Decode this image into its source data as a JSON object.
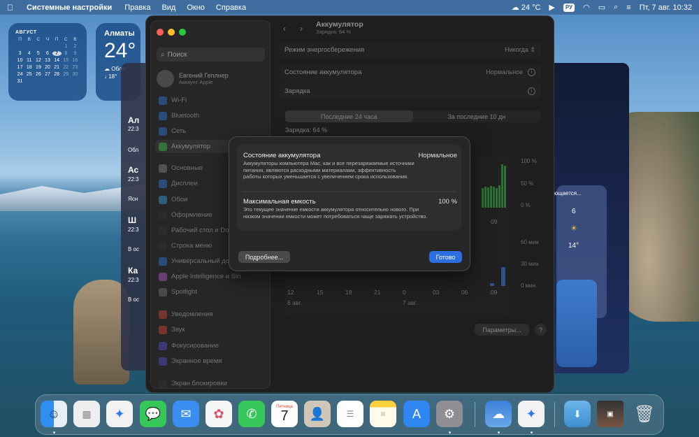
{
  "menubar": {
    "app_name": "Системные настройки",
    "menus": [
      "Правка",
      "Вид",
      "Окно",
      "Справка"
    ],
    "weather": "24 °C",
    "keyboard": "РУ",
    "datetime": "Пт, 7 авг.  10:32"
  },
  "calendar_widget": {
    "month": "АВГУСТ",
    "weekdays": [
      "П",
      "В",
      "С",
      "Ч",
      "П",
      "С",
      "В"
    ],
    "days": [
      "",
      "",
      "",
      "",
      "",
      "1",
      "2",
      "3",
      "4",
      "5",
      "6",
      "7",
      "8",
      "9",
      "10",
      "11",
      "12",
      "13",
      "14",
      "15",
      "16",
      "17",
      "18",
      "19",
      "20",
      "21",
      "22",
      "23",
      "24",
      "25",
      "26",
      "27",
      "28",
      "29",
      "30",
      "31"
    ],
    "today": "7"
  },
  "weather_widget": {
    "city": "Алматы",
    "temp": "24°",
    "condition": "Обла",
    "low": "↓ 18°"
  },
  "bg_left_window": {
    "items": [
      "Ал",
      "22:3",
      "Обл",
      "Ас",
      "22:3",
      "Ясн",
      "Ш",
      "22:3",
      "В ос",
      "Ка",
      "22:3",
      "В ос"
    ]
  },
  "bg_right_window": {
    "text1": "ющается...",
    "num": "6",
    "temp": "14°"
  },
  "sidebar": {
    "search_placeholder": "Поиск",
    "account_name": "Евгений Геплнер",
    "account_sub": "Аккаунт Apple",
    "items": [
      {
        "label": "Wi-Fi",
        "color": "#2f7be0"
      },
      {
        "label": "Bluetooth",
        "color": "#2f7be0"
      },
      {
        "label": "Сеть",
        "color": "#2f7be0"
      },
      {
        "label": "Аккумулятор",
        "color": "#3bb34a"
      },
      {
        "label": "Основные",
        "color": "#888888"
      },
      {
        "label": "Дисплеи",
        "color": "#2f7be0"
      },
      {
        "label": "Обои",
        "color": "#34a8e0"
      },
      {
        "label": "Оформление",
        "color": "#333333"
      },
      {
        "label": "Рабочий стол и Dock",
        "color": "#333333"
      },
      {
        "label": "Строка меню",
        "color": "#333333"
      },
      {
        "label": "Универсальный доступ",
        "color": "#2f7be0"
      },
      {
        "label": "Apple Intelligence и Siri",
        "color": "#c05ad6"
      },
      {
        "label": "Spotlight",
        "color": "#777777"
      },
      {
        "label": "Уведомления",
        "color": "#e0453a"
      },
      {
        "label": "Звук",
        "color": "#e0453a"
      },
      {
        "label": "Фокусирование",
        "color": "#5a4fd6"
      },
      {
        "label": "Экранное время",
        "color": "#5a4fd6"
      },
      {
        "label": "Экран блокировки",
        "color": "#333333"
      }
    ]
  },
  "content": {
    "title": "Аккумулятор",
    "subtitle": "Зарядка: 64 %",
    "low_power_label": "Режим энергосбережения",
    "low_power_value": "Никогда",
    "health_label": "Состояние аккумулятора",
    "health_value": "Нормальное",
    "charging_label": "Зарядка",
    "seg_24h": "Последние 24 часа",
    "seg_10d": "За последние 10 дн",
    "charge_level": "Зарядка: 64 %",
    "level_axis": [
      "100 %",
      "50 %",
      "0 %"
    ],
    "usage_axis": [
      "60 мин",
      "30 мин",
      "0 мин"
    ],
    "x_ticks_top": [
      "09"
    ],
    "x_ticks": [
      "12",
      "15",
      "18",
      "21",
      "0",
      "03",
      "06",
      "09"
    ],
    "date_labels": [
      "6 авг.",
      "7 авг."
    ],
    "params_button": "Параметры...",
    "help_button": "?"
  },
  "sheet": {
    "health_title": "Состояние аккумулятора",
    "health_value": "Нормальное",
    "health_desc": "Аккумуляторы компьютера Mac, как и все перезаряжаемые источники питания, являются расходными материалами, эффективность работы которых уменьшается с увеличением срока использования.",
    "capacity_title": "Максимальная емкость",
    "capacity_value": "100 %",
    "capacity_desc": "Это текущее значение емкости аккумулятора относительно нового. При низком значении емкости может потребоваться чаще заряжать устройство.",
    "more_button": "Подробнее...",
    "done_button": "Готово"
  },
  "dock": {
    "calendar_weekday": "Пятница",
    "calendar_day": "7",
    "icons": [
      "finder-icon",
      "launchpad-icon",
      "safari-icon",
      "messages-icon",
      "mail-icon",
      "photos-icon",
      "phone-icon",
      "calendar-icon",
      "contacts-icon",
      "reminders-icon",
      "notes-icon",
      "app-store-icon",
      "system-settings-icon",
      "weather-icon",
      "safari-icon",
      "downloads-icon",
      "screen-thumb-icon",
      "trash-icon"
    ]
  }
}
